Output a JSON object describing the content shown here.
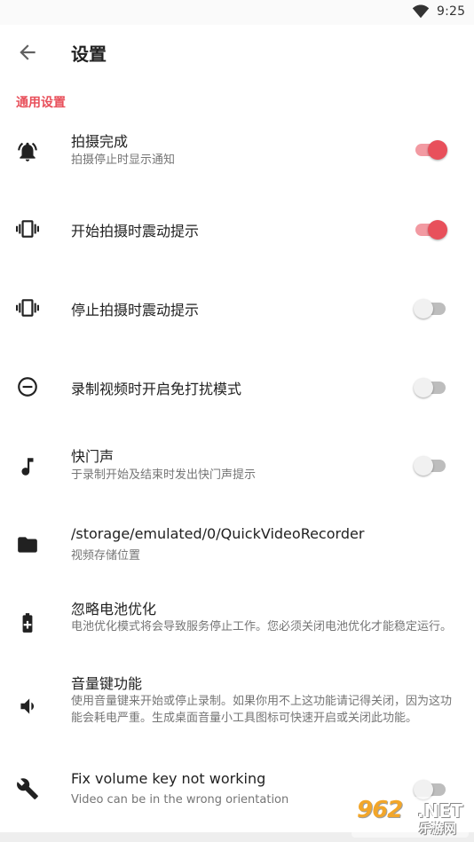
{
  "status_bar": {
    "time": "9:25",
    "wifi_icon": "wifi-icon"
  },
  "app_bar": {
    "back_icon": "arrow-back-icon",
    "title": "设置"
  },
  "section": {
    "title": "通用设置"
  },
  "settings": [
    {
      "icon": "bell-ring-icon",
      "title": "拍摄完成",
      "summary": "拍摄停止时显示通知",
      "switch_on": true
    },
    {
      "icon": "vibration-icon",
      "title": "开始拍摄时震动提示",
      "switch_on": true
    },
    {
      "icon": "vibration-icon",
      "title": "停止拍摄时震动提示",
      "switch_on": false
    },
    {
      "icon": "minus-circle-icon",
      "title": "录制视频时开启免打扰模式",
      "switch_on": false
    },
    {
      "icon": "music-note-icon",
      "title": "快门声",
      "summary": "于录制开始及结束时发出快门声提示",
      "switch_on": false
    },
    {
      "icon": "folder-icon",
      "title": "/storage/emulated/0/QuickVideoRecorder",
      "summary": "视频存储位置"
    },
    {
      "icon": "battery-plus-icon",
      "title": "忽略电池优化",
      "summary": "电池优化模式将会导致服务停止工作。您必须关闭电池优化才能稳定运行。"
    },
    {
      "icon": "volume-icon",
      "title": "音量键功能",
      "summary": "使用音量键来开始或停止录制。如果你用不上这功能请记得关闭，因为这功能会耗电严重。生成桌面音量小工具图标可快速开启或关闭此功能。"
    },
    {
      "icon": "wrench-icon",
      "title": "Fix volume key not working",
      "summary": "Video can be in the wrong orientation",
      "switch_on": false
    }
  ],
  "watermark": {
    "brand": "962",
    "domain": ".NET",
    "sub": "乐游网"
  },
  "colors": {
    "accent": "#e8505b",
    "accent_track": "#f29aa2",
    "text_primary": "#212121",
    "text_secondary": "#757575"
  }
}
